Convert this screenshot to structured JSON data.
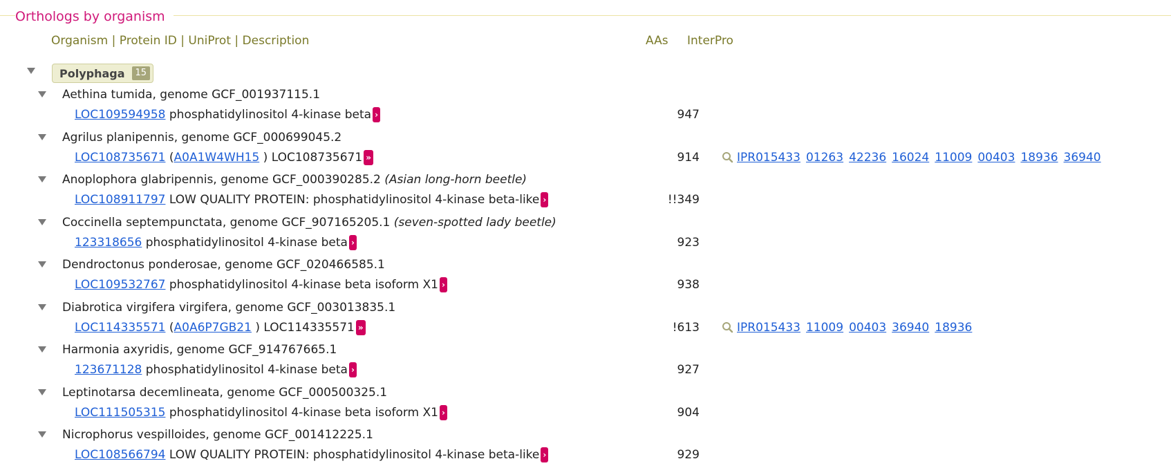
{
  "section": {
    "title": "Orthologs by organism"
  },
  "columns": {
    "organism": "Organism",
    "protein_id": "Protein ID",
    "uniprot": "UniProt",
    "description": "Description",
    "sep": "|",
    "aas": "AAs",
    "interpro": "InterPro"
  },
  "group": {
    "name": "Polyphaga",
    "count": "15"
  },
  "more_single": "›",
  "more_double": "»",
  "rows": [
    {
      "organism": "Aethina tumida, genome GCF_001937115.1",
      "common": "",
      "protein_id": "LOC109594958",
      "uniprot_pre": "",
      "uniprot": "",
      "uniprot_post": "",
      "description": "phosphatidylinositol 4-kinase beta",
      "more": "single",
      "aas": "947",
      "interpro": []
    },
    {
      "organism": "Agrilus planipennis, genome GCF_000699045.2",
      "common": "",
      "protein_id": "LOC108735671",
      "uniprot_pre": "(",
      "uniprot": "A0A1W4WH15",
      "uniprot_post": ")",
      "description": "LOC108735671",
      "more": "double",
      "aas": "914",
      "interpro": [
        "IPR015433",
        "01263",
        "42236",
        "16024",
        "11009",
        "00403",
        "18936",
        "36940"
      ]
    },
    {
      "organism": "Anoplophora glabripennis, genome GCF_000390285.2",
      "common": "(Asian long-horn beetle)",
      "protein_id": "LOC108911797",
      "uniprot_pre": "",
      "uniprot": "",
      "uniprot_post": "",
      "description": "LOW QUALITY PROTEIN: phosphatidylinositol 4-kinase beta-like",
      "more": "single",
      "aas": "!!349",
      "interpro": []
    },
    {
      "organism": "Coccinella septempunctata, genome GCF_907165205.1",
      "common": "(seven-spotted lady beetle)",
      "protein_id": "123318656",
      "uniprot_pre": "",
      "uniprot": "",
      "uniprot_post": "",
      "description": "phosphatidylinositol 4-kinase beta",
      "more": "single",
      "aas": "923",
      "interpro": []
    },
    {
      "organism": "Dendroctonus ponderosae, genome GCF_020466585.1",
      "common": "",
      "protein_id": "LOC109532767",
      "uniprot_pre": "",
      "uniprot": "",
      "uniprot_post": "",
      "description": "phosphatidylinositol 4-kinase beta isoform X1",
      "more": "single",
      "aas": "938",
      "interpro": []
    },
    {
      "organism": "Diabrotica virgifera virgifera, genome GCF_003013835.1",
      "common": "",
      "protein_id": "LOC114335571",
      "uniprot_pre": "(",
      "uniprot": "A0A6P7GB21",
      "uniprot_post": ")",
      "description": "LOC114335571",
      "more": "double",
      "aas": "!613",
      "interpro": [
        "IPR015433",
        "11009",
        "00403",
        "36940",
        "18936"
      ]
    },
    {
      "organism": "Harmonia axyridis, genome GCF_914767665.1",
      "common": "",
      "protein_id": "123671128",
      "uniprot_pre": "",
      "uniprot": "",
      "uniprot_post": "",
      "description": "phosphatidylinositol 4-kinase beta",
      "more": "single",
      "aas": "927",
      "interpro": []
    },
    {
      "organism": "Leptinotarsa decemlineata, genome GCF_000500325.1",
      "common": "",
      "protein_id": "LOC111505315",
      "uniprot_pre": "",
      "uniprot": "",
      "uniprot_post": "",
      "description": "phosphatidylinositol 4-kinase beta isoform X1",
      "more": "single",
      "aas": "904",
      "interpro": []
    },
    {
      "organism": "Nicrophorus vespilloides, genome GCF_001412225.1",
      "common": "",
      "protein_id": "LOC108566794",
      "uniprot_pre": "",
      "uniprot": "",
      "uniprot_post": "",
      "description": "LOW QUALITY PROTEIN: phosphatidylinositol 4-kinase beta-like",
      "more": "single",
      "aas": "929",
      "interpro": []
    }
  ]
}
